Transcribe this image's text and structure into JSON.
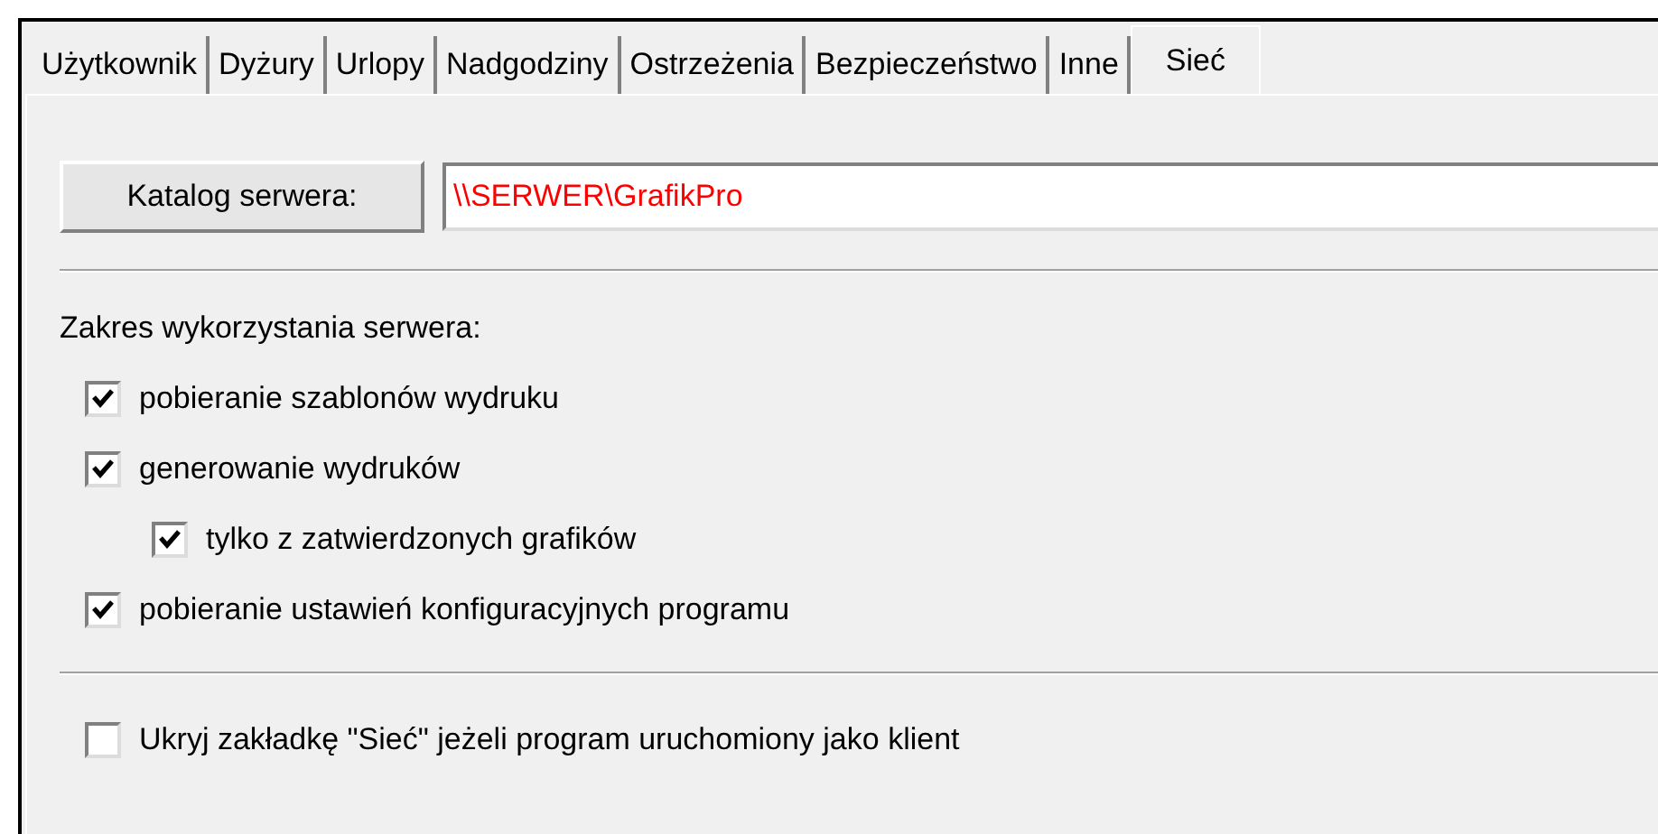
{
  "tabs": [
    {
      "label": "Użytkownik",
      "selected": false
    },
    {
      "label": "Dyżury",
      "selected": false
    },
    {
      "label": "Urlopy",
      "selected": false
    },
    {
      "label": "Nadgodziny",
      "selected": false
    },
    {
      "label": "Ostrzeżenia",
      "selected": false
    },
    {
      "label": "Bezpieczeństwo",
      "selected": false
    },
    {
      "label": "Inne",
      "selected": false
    },
    {
      "label": "Sieć",
      "selected": true
    }
  ],
  "server": {
    "button": "Katalog serwera:",
    "value": "\\\\SERWER\\GrafikPro"
  },
  "usage": {
    "label": "Zakres wykorzystania serwera:",
    "options": [
      {
        "label": "pobieranie szablonów wydruku",
        "checked": true
      },
      {
        "label": "generowanie wydruków",
        "checked": true,
        "children": [
          {
            "label": "tylko z zatwierdzonych grafików",
            "checked": true
          }
        ]
      },
      {
        "label": "pobieranie ustawień konfiguracyjnych programu",
        "checked": true
      }
    ]
  },
  "hide_tab": {
    "label": "Ukryj zakładkę \"Sieć\" jeżeli program uruchomiony jako klient",
    "checked": false
  }
}
